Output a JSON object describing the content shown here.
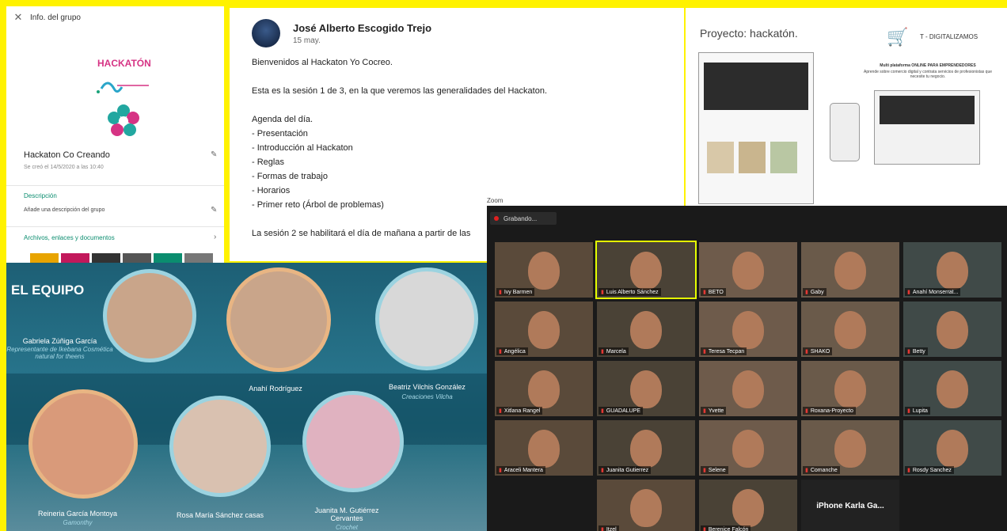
{
  "group_info": {
    "header": "Info. del grupo",
    "close_icon": "close-icon",
    "logo_text": "HACKATÓN",
    "group_name": "Hackaton Co Creando",
    "created": "Se creó el 14/5/2020 a las 10:40",
    "description_label": "Descripción",
    "description_placeholder": "Añade una descripción del grupo",
    "files_label": "Archivos, enlaces y documentos"
  },
  "post": {
    "author": "José Alberto Escogido Trejo",
    "date": "15 may.",
    "lines": [
      "Bienvenidos al Hackaton Yo Cocreo.",
      "",
      "Esta es la sesión 1 de 3, en la que veremos las generalidades del Hackaton.",
      "",
      "Agenda del día.",
      "- Presentación",
      "- Introducción al Hackaton",
      "- Reglas",
      "- Formas de trabajo",
      "- Horarios",
      "- Primer reto (Árbol de problemas)",
      "",
      "La sesión 2 se habilitará el día de mañana a partir de las"
    ]
  },
  "project": {
    "title": "Proyecto: hackatón.",
    "brand": "T - DIGITALIZAMOS",
    "tagline_bold": "Multi plataforma ONLINE PARA EMPRENDEDORES",
    "tagline": "Aprende sobre comercio digital y contrata servicios de profesionistas que necesite tu negocio."
  },
  "team": {
    "heading": "EL EQUIPO",
    "members": [
      {
        "name": "Gabriela  Zúñiga García",
        "role": "Representante de Ikebana Cosmética natural for theens"
      },
      {
        "name": "Anahí Rodríguez",
        "role": ""
      },
      {
        "name": "Beatriz Vilchis González",
        "role": "Creaciones Vilcha"
      },
      {
        "name": "Reineria García Montoya",
        "role": "Gamonthy"
      },
      {
        "name": "Rosa María Sánchez casas",
        "role": ""
      },
      {
        "name": "Juanita M. Gutiérrez Cervantes",
        "role": "Crochet"
      }
    ]
  },
  "zoom": {
    "app_title": "Zoom",
    "recording": "Grabando...",
    "participants": [
      "Ivy Barmen",
      "Luis Alberto Sánchez",
      "BETO",
      "Gaby",
      "Anahí Monserrat...",
      "Angélica",
      "Marcela",
      "Teresa Tecpan",
      "SHAKO",
      "Betty",
      "Xitlana Rangel",
      "GUADALUPE",
      "Yvette",
      "Roxana-Proyecto",
      "Lupita",
      "Araceli Mantera",
      "Juanita Gutierrez",
      "Selene",
      "Comanche",
      "Rosdy Sanchez",
      "Itzel",
      "Berenice Falcón",
      "iPhone Karla Ga..."
    ]
  },
  "colors": {
    "frame": "#fff200",
    "zoom_active": "#e5ff00",
    "accent_green": "#0b8d6f",
    "logo_pink": "#d63384"
  }
}
